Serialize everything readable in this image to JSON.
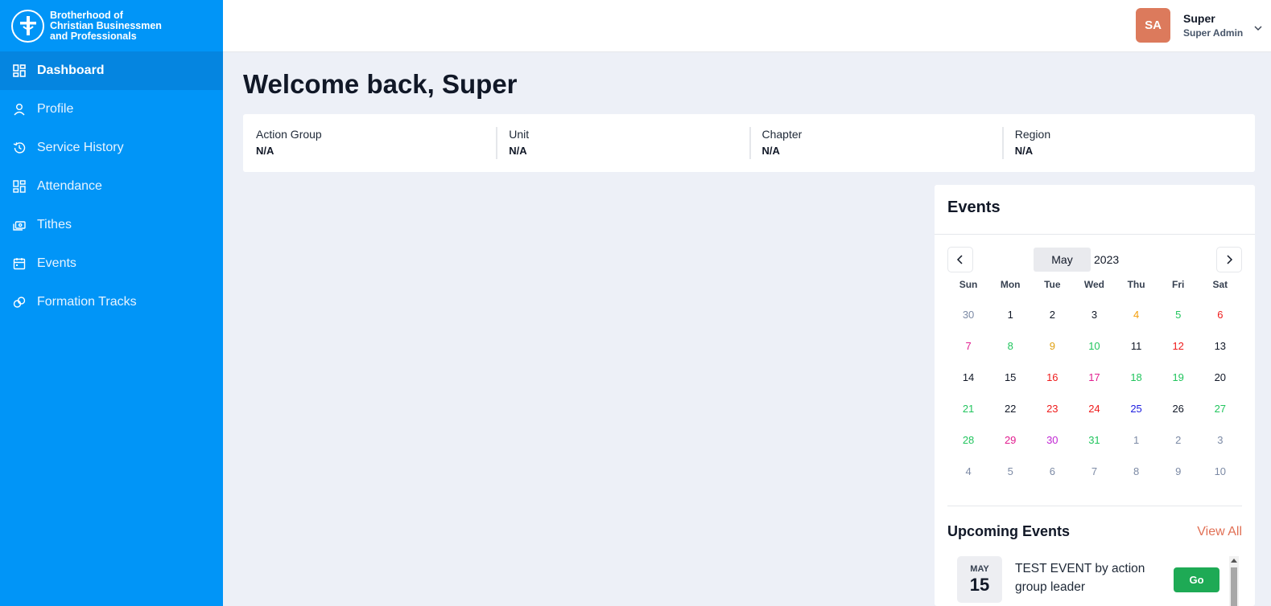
{
  "brand": {
    "name": "Brotherhood of Christian Businessmen and Professionals",
    "lines": [
      "Brotherhood of",
      "Christian Businessmen",
      "and Professionals"
    ]
  },
  "sidebar": {
    "items": [
      {
        "label": "Dashboard",
        "icon": "dashboard-icon",
        "active": true
      },
      {
        "label": "Profile",
        "icon": "user-icon",
        "active": false
      },
      {
        "label": "Service History",
        "icon": "history-icon",
        "active": false
      },
      {
        "label": "Attendance",
        "icon": "grid-icon",
        "active": false
      },
      {
        "label": "Tithes",
        "icon": "money-icon",
        "active": false
      },
      {
        "label": "Events",
        "icon": "calendar-icon",
        "active": false
      },
      {
        "label": "Formation Tracks",
        "icon": "links-icon",
        "active": false
      }
    ]
  },
  "header": {
    "avatar_initials": "SA",
    "user_name": "Super",
    "user_role": "Super Admin"
  },
  "main": {
    "title": "Welcome back, Super",
    "info": [
      {
        "label": "Action Group",
        "value": "N/A"
      },
      {
        "label": "Unit",
        "value": "N/A"
      },
      {
        "label": "Chapter",
        "value": "N/A"
      },
      {
        "label": "Region",
        "value": "N/A"
      }
    ]
  },
  "events": {
    "title": "Events",
    "calendar": {
      "month": "May",
      "year": "2023",
      "weekdays": [
        "Sun",
        "Mon",
        "Tue",
        "Wed",
        "Thu",
        "Fri",
        "Sat"
      ],
      "weeks": [
        [
          {
            "d": "30",
            "c": "#7c8aa5"
          },
          {
            "d": "1",
            "c": "#111827"
          },
          {
            "d": "2",
            "c": "#111827"
          },
          {
            "d": "3",
            "c": "#111827"
          },
          {
            "d": "4",
            "c": "#f59e0b"
          },
          {
            "d": "5",
            "c": "#22c55e"
          },
          {
            "d": "6",
            "c": "#ef1c1c"
          }
        ],
        [
          {
            "d": "7",
            "c": "#e11d8f"
          },
          {
            "d": "8",
            "c": "#22c55e"
          },
          {
            "d": "9",
            "c": "#e0a010"
          },
          {
            "d": "10",
            "c": "#22c55e"
          },
          {
            "d": "11",
            "c": "#111827"
          },
          {
            "d": "12",
            "c": "#ef1c1c"
          },
          {
            "d": "13",
            "c": "#111827"
          }
        ],
        [
          {
            "d": "14",
            "c": "#111827"
          },
          {
            "d": "15",
            "c": "#111827"
          },
          {
            "d": "16",
            "c": "#ef1c1c"
          },
          {
            "d": "17",
            "c": "#e11d8f"
          },
          {
            "d": "18",
            "c": "#22c55e"
          },
          {
            "d": "19",
            "c": "#22c55e"
          },
          {
            "d": "20",
            "c": "#111827"
          }
        ],
        [
          {
            "d": "21",
            "c": "#22c55e"
          },
          {
            "d": "22",
            "c": "#111827"
          },
          {
            "d": "23",
            "c": "#ef1c1c"
          },
          {
            "d": "24",
            "c": "#ef1c1c"
          },
          {
            "d": "25",
            "c": "#1d1de0"
          },
          {
            "d": "26",
            "c": "#111827"
          },
          {
            "d": "27",
            "c": "#22c55e"
          }
        ],
        [
          {
            "d": "28",
            "c": "#22c55e"
          },
          {
            "d": "29",
            "c": "#e11d8f"
          },
          {
            "d": "30",
            "c": "#c026d3"
          },
          {
            "d": "31",
            "c": "#22c55e"
          },
          {
            "d": "1",
            "c": "#7c8aa5"
          },
          {
            "d": "2",
            "c": "#7c8aa5"
          },
          {
            "d": "3",
            "c": "#7c8aa5"
          }
        ],
        [
          {
            "d": "4",
            "c": "#7c8aa5"
          },
          {
            "d": "5",
            "c": "#7c8aa5"
          },
          {
            "d": "6",
            "c": "#7c8aa5"
          },
          {
            "d": "7",
            "c": "#7c8aa5"
          },
          {
            "d": "8",
            "c": "#7c8aa5"
          },
          {
            "d": "9",
            "c": "#7c8aa5"
          },
          {
            "d": "10",
            "c": "#7c8aa5"
          }
        ]
      ]
    },
    "upcoming_title": "Upcoming Events",
    "view_all": "View All",
    "upcoming": [
      {
        "month": "MAY",
        "day": "15",
        "title": "TEST EVENT by action group leader",
        "button": "Go"
      }
    ]
  },
  "colors": {
    "sidebar": "#0195f7",
    "sidebar_active": "#0585e0",
    "accent": "#e17055",
    "go": "#1eaa55",
    "avatar": "#dc7a5c"
  }
}
